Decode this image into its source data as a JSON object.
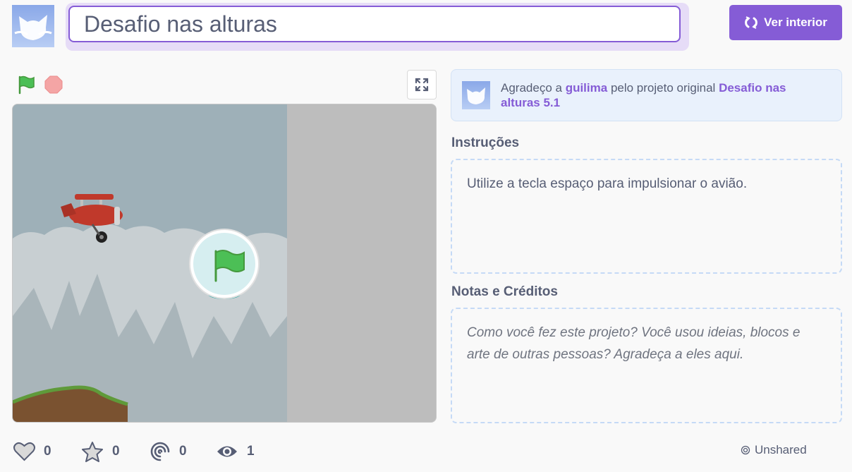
{
  "project": {
    "title": "Desafio nas alturas"
  },
  "header": {
    "see_inside_label": "Ver interior"
  },
  "remix": {
    "prefix": "Agradeço a",
    "user": "guilima",
    "middle": "pelo projeto original",
    "project": "Desafio nas alturas 5.1"
  },
  "instructions": {
    "label": "Instruções",
    "text": "Utilize a tecla espaço para impulsionar o avião."
  },
  "notes": {
    "label": "Notas e Créditos",
    "placeholder": "Como você fez este projeto? Você usou ideias, blocos e arte de outras pessoas? Agradeça a eles aqui."
  },
  "stats": {
    "loves": "0",
    "favorites": "0",
    "remixes": "0",
    "views": "1"
  },
  "share_status": "Unshared",
  "icons": [
    "cat-avatar-icon",
    "see-inside-icon",
    "green-flag-icon",
    "stop-icon",
    "fullscreen-icon",
    "heart-icon",
    "star-icon",
    "remix-icon",
    "eye-icon",
    "unshared-icon"
  ],
  "colors": {
    "accent": "#855cd6",
    "text": "#575e75",
    "remix_bg": "#e9f1fc",
    "stage_sky": "#9eb0b8",
    "flag_green": "#4cbf56",
    "stop_red": "#ec5959"
  }
}
